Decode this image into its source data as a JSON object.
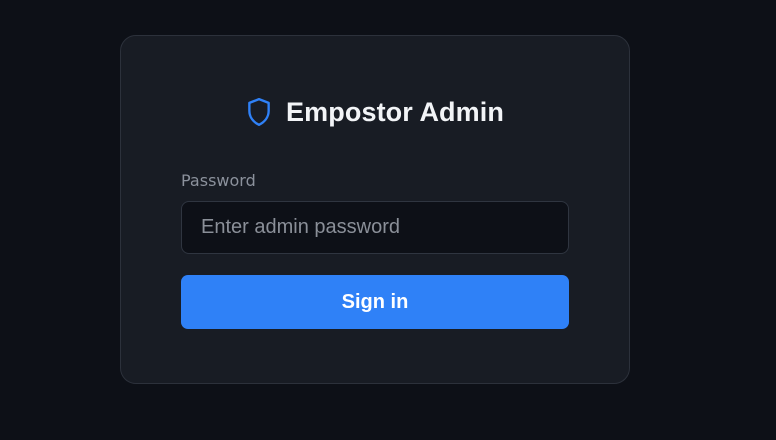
{
  "brand": {
    "title": "Empostor Admin",
    "icon": "shield-icon",
    "icon_color": "#2f81f7"
  },
  "login_form": {
    "password_label": "Password",
    "password_placeholder": "Enter admin password",
    "password_value": "",
    "submit_label": "Sign in"
  },
  "colors": {
    "background": "#0d1017",
    "card": "#181c24",
    "accent": "#2f81f7"
  }
}
